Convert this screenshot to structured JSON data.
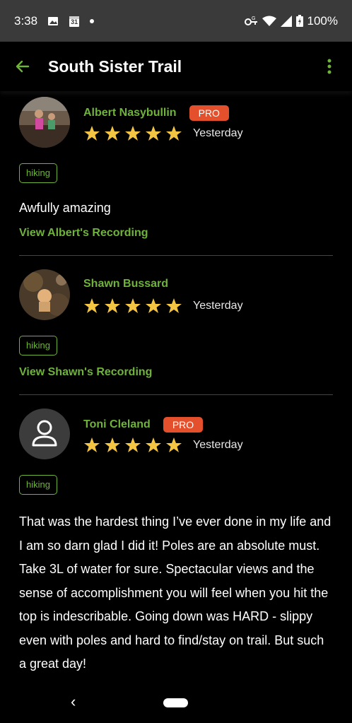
{
  "status": {
    "time": "3:38",
    "calendar_day": "31",
    "battery": "100%",
    "icons": [
      "image-icon",
      "calendar-icon",
      "dot-icon",
      "key-icon",
      "wifi-icon",
      "signal-icon",
      "battery-icon"
    ]
  },
  "header": {
    "title": "South Sister Trail",
    "back_icon": "arrow-left-icon",
    "more_icon": "more-vert-icon"
  },
  "colors": {
    "accent": "#6fb33a",
    "pro_badge": "#e5502c",
    "star": "#f4c542"
  },
  "reviews": [
    {
      "name": "Albert Nasybullin",
      "pro_label": "PRO",
      "rating": 5,
      "date": "Yesterday",
      "tag": "hiking",
      "comment": "Awfully amazing",
      "link": "View Albert's Recording"
    },
    {
      "name": "Shawn Bussard",
      "rating": 5,
      "date": "Yesterday",
      "tag": "hiking",
      "link": "View Shawn's Recording"
    },
    {
      "name": "Toni Cleland",
      "pro_label": "PRO",
      "rating": 5,
      "date": "Yesterday",
      "tag": "hiking",
      "comment": "That was the hardest thing I’ve ever done in my life and I am so darn glad I did it!  Poles are an absolute must. Take 3L of water for sure. Spectacular views and the sense of accomplishment you will feel when you hit the top is indescribable. Going down was HARD - slippy even with poles and hard to find/stay on trail. But such a great day!"
    }
  ],
  "nav": {
    "back_glyph": "‹"
  }
}
